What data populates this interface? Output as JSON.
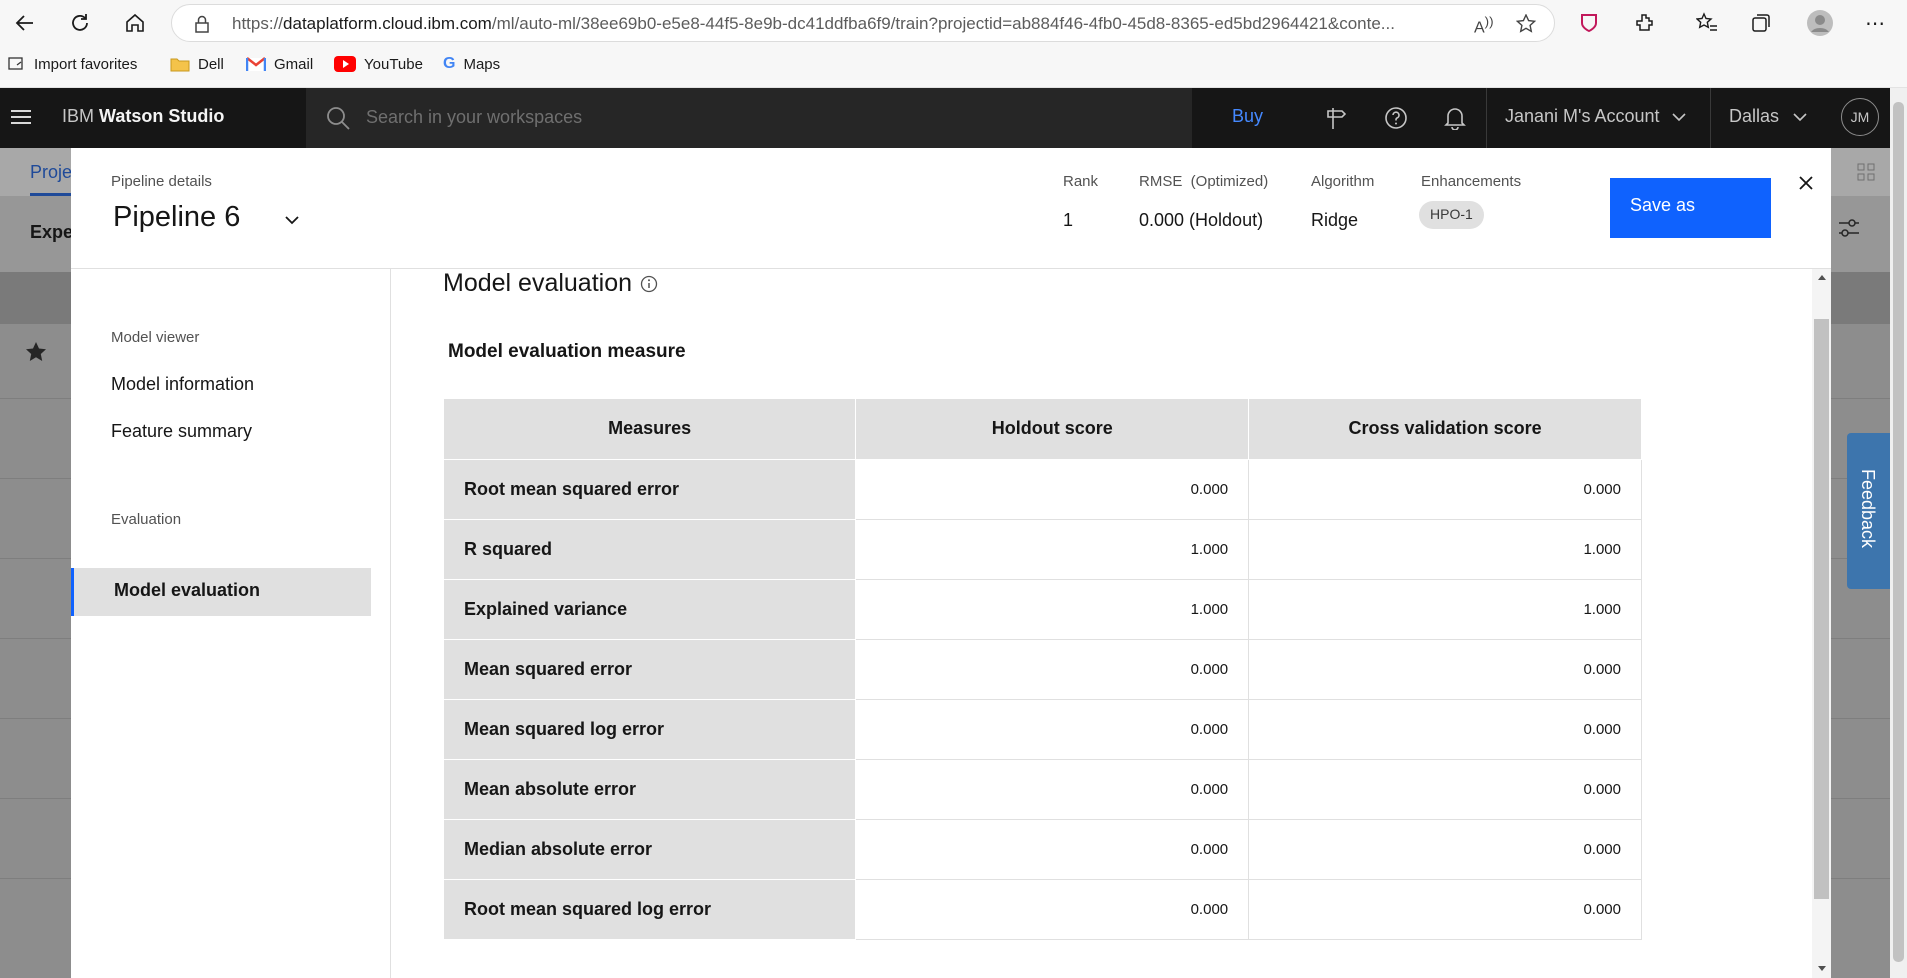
{
  "browser": {
    "url_prefix": "https://",
    "url_host": "dataplatform.cloud.ibm.com",
    "url_path": "/ml/auto-ml/38ee69b0-e5e8-44f5-8e9b-dc41ddfba6f9/train?projectid=ab884f46-4fb0-45d8-8365-ed5bd2964421&conte...",
    "favorites": [
      "Import favorites",
      "Dell",
      "Gmail",
      "YouTube",
      "Maps"
    ]
  },
  "app": {
    "brand_prefix": "IBM ",
    "brand_name": "Watson Studio",
    "search_placeholder": "Search in your workspaces",
    "buy": "Buy",
    "account": "Janani M's Account",
    "region": "Dallas",
    "avatar": "JM",
    "bg_tab": "Proje",
    "bg_subtitle": "Expe"
  },
  "modal": {
    "pipeline_label": "Pipeline details",
    "pipeline_name": "Pipeline 6",
    "rank_label": "Rank",
    "rank_value": "1",
    "rmse_label": "RMSE  (Optimized)",
    "rmse_value": "0.000 (Holdout)",
    "algorithm_label": "Algorithm",
    "algorithm_value": "Ridge",
    "enhancements_label": "Enhancements",
    "enhancement_tag": "HPO-1",
    "save_label": "Save as"
  },
  "sidenav": {
    "viewer_heading": "Model viewer",
    "model_information": "Model information",
    "feature_summary": "Feature summary",
    "evaluation_heading": "Evaluation",
    "model_evaluation": "Model evaluation"
  },
  "evaluation": {
    "title": "Model evaluation",
    "subtitle": "Model evaluation measure",
    "columns": [
      "Measures",
      "Holdout score",
      "Cross validation score"
    ],
    "rows": [
      {
        "measure": "Root mean squared error",
        "holdout": "0.000",
        "cv": "0.000"
      },
      {
        "measure": "R squared",
        "holdout": "1.000",
        "cv": "1.000"
      },
      {
        "measure": "Explained variance",
        "holdout": "1.000",
        "cv": "1.000"
      },
      {
        "measure": "Mean squared error",
        "holdout": "0.000",
        "cv": "0.000"
      },
      {
        "measure": "Mean squared log error",
        "holdout": "0.000",
        "cv": "0.000"
      },
      {
        "measure": "Mean absolute error",
        "holdout": "0.000",
        "cv": "0.000"
      },
      {
        "measure": "Median absolute error",
        "holdout": "0.000",
        "cv": "0.000"
      },
      {
        "measure": "Root mean squared log error",
        "holdout": "0.000",
        "cv": "0.000"
      }
    ]
  },
  "feedback": "Feedback",
  "colors": {
    "primary": "#0f62fe",
    "header": "#161616",
    "feedback": "#3d75ad"
  }
}
